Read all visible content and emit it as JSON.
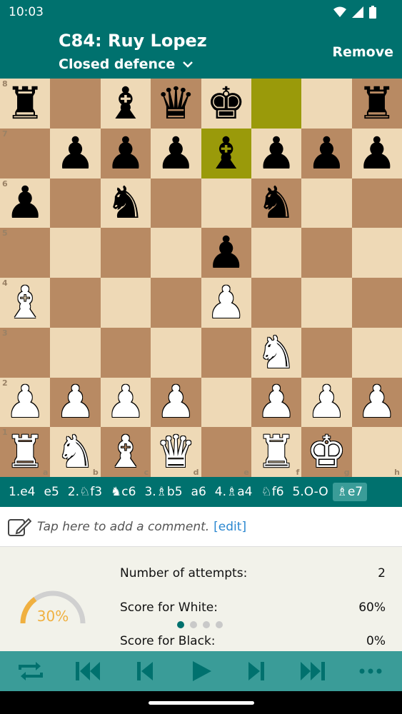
{
  "status_bar": {
    "time": "10:03",
    "icons": [
      "wifi-icon",
      "signal-icon",
      "battery-icon"
    ]
  },
  "header": {
    "title": "C84: Ruy Lopez",
    "subtitle": "Closed defence",
    "remove_label": "Remove"
  },
  "board": {
    "ranks": [
      "8",
      "7",
      "6",
      "5",
      "4",
      "3",
      "2",
      "1"
    ],
    "files": [
      "a",
      "b",
      "c",
      "d",
      "e",
      "f",
      "g",
      "h"
    ],
    "position": [
      [
        "bR",
        "",
        "bB",
        "bQ",
        "bK",
        "",
        "",
        "bR"
      ],
      [
        "",
        "bP",
        "bP",
        "bP",
        "bB",
        "bP",
        "bP",
        "bP"
      ],
      [
        "bP",
        "",
        "bN",
        "",
        "",
        "bN",
        "",
        ""
      ],
      [
        "",
        "",
        "",
        "",
        "bP",
        "",
        "",
        ""
      ],
      [
        "wB",
        "",
        "",
        "",
        "wP",
        "",
        "",
        ""
      ],
      [
        "",
        "",
        "",
        "",
        "",
        "wN",
        "",
        ""
      ],
      [
        "wP",
        "wP",
        "wP",
        "wP",
        "",
        "wP",
        "wP",
        "wP"
      ],
      [
        "wR",
        "wN",
        "wB",
        "wQ",
        "",
        "wR",
        "wK",
        ""
      ]
    ],
    "last_move_squares": [
      "f8",
      "e7"
    ],
    "colors": {
      "light": "#eed9b6",
      "dark": "#b88a63",
      "highlight": "#9a9a0a"
    }
  },
  "moves": [
    {
      "text": "1.e4",
      "current": false
    },
    {
      "text": "e5",
      "current": false
    },
    {
      "text": "2.♘f3",
      "current": false
    },
    {
      "text": "♞c6",
      "current": false
    },
    {
      "text": "3.♗b5",
      "current": false
    },
    {
      "text": "a6",
      "current": false
    },
    {
      "text": "4.♗a4",
      "current": false
    },
    {
      "text": "♘f6",
      "current": false
    },
    {
      "text": "5.O-O",
      "current": false
    },
    {
      "text": "♗e7",
      "current": true
    }
  ],
  "comment": {
    "placeholder": "Tap here to add a comment.",
    "edit_label": "[edit]"
  },
  "stats": {
    "gauge_value": "30%",
    "gauge_fraction": 0.3,
    "rows": [
      {
        "label": "Number of attempts:",
        "value": "2"
      },
      {
        "label": "Score for White:",
        "value": "60%"
      },
      {
        "label": "Score for Black:",
        "value": "0%"
      }
    ],
    "page_dots": 4,
    "active_dot": 0
  },
  "toolbar": {
    "buttons": [
      "flip-board-icon",
      "first-move-icon",
      "previous-move-icon",
      "play-icon",
      "next-move-icon",
      "last-move-icon",
      "more-icon"
    ]
  },
  "theme": {
    "primary": "#00716e",
    "toolbar": "#3a9c98",
    "accent": "#f0b040"
  }
}
